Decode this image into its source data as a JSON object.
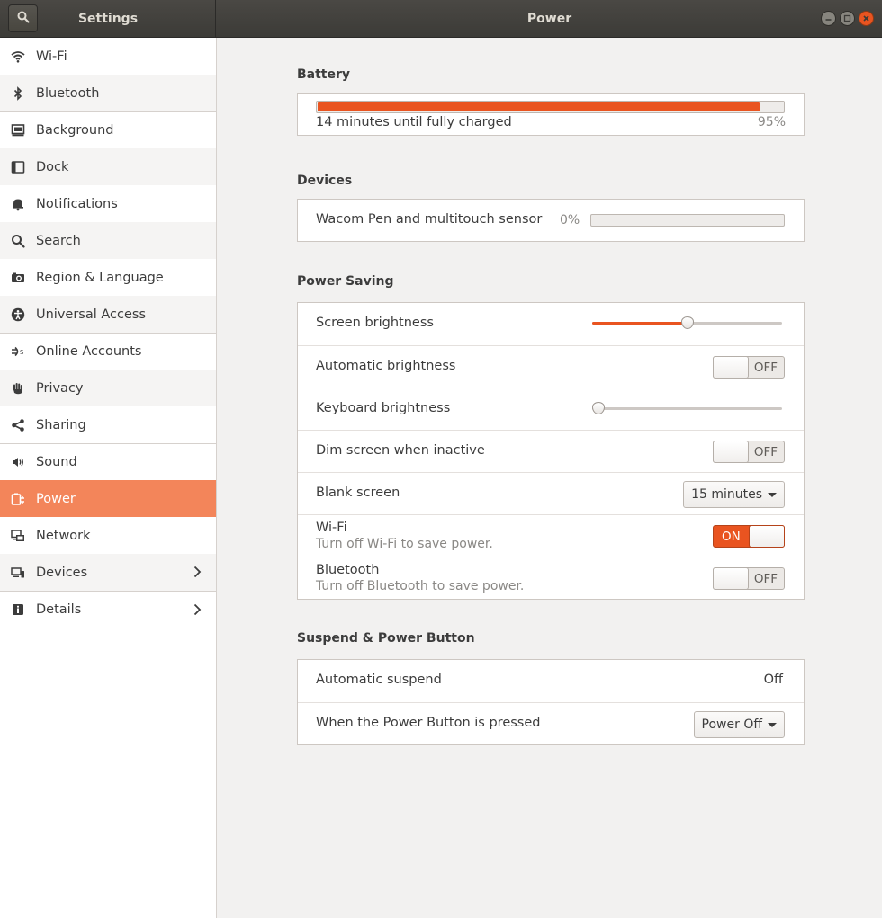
{
  "header": {
    "left_title": "Settings",
    "right_title": "Power",
    "search_icon": "search-icon",
    "window_buttons": [
      "minimize",
      "maximize",
      "close"
    ]
  },
  "sidebar": {
    "items": [
      {
        "label": "Wi-Fi",
        "icon": "wifi-icon"
      },
      {
        "label": "Bluetooth",
        "icon": "bluetooth-icon"
      },
      {
        "label": "Background",
        "icon": "background-icon"
      },
      {
        "label": "Dock",
        "icon": "dock-icon"
      },
      {
        "label": "Notifications",
        "icon": "bell-icon"
      },
      {
        "label": "Search",
        "icon": "search-icon"
      },
      {
        "label": "Region & Language",
        "icon": "camera-icon"
      },
      {
        "label": "Universal Access",
        "icon": "accessibility-icon"
      },
      {
        "label": "Online Accounts",
        "icon": "online-accounts-icon"
      },
      {
        "label": "Privacy",
        "icon": "hand-icon"
      },
      {
        "label": "Sharing",
        "icon": "share-icon"
      },
      {
        "label": "Sound",
        "icon": "speaker-icon"
      },
      {
        "label": "Power",
        "icon": "power-icon",
        "active": true
      },
      {
        "label": "Network",
        "icon": "network-icon"
      },
      {
        "label": "Devices",
        "icon": "devices-icon",
        "has_chevron": true
      },
      {
        "label": "Details",
        "icon": "info-icon",
        "has_chevron": true
      }
    ]
  },
  "battery": {
    "title": "Battery",
    "status": "14 minutes until fully charged",
    "percent_text": "95%",
    "level": 0.95
  },
  "devices": {
    "title": "Devices",
    "name": "Wacom Pen and multitouch sensor",
    "percent_text": "0%",
    "level": 0.0
  },
  "power_saving": {
    "title": "Power Saving",
    "screen_brightness": {
      "label": "Screen brightness",
      "level": 0.5
    },
    "automatic_brightness": {
      "label": "Automatic brightness",
      "state": "OFF"
    },
    "keyboard_brightness": {
      "label": "Keyboard brightness",
      "level": 0.0
    },
    "dim_screen": {
      "label": "Dim screen when inactive",
      "state": "OFF"
    },
    "blank_screen": {
      "label": "Blank screen",
      "value": "15 minutes"
    },
    "wifi": {
      "label": "Wi-Fi",
      "sub": "Turn off Wi-Fi to save power.",
      "state": "ON"
    },
    "bluetooth": {
      "label": "Bluetooth",
      "sub": "Turn off Bluetooth to save power.",
      "state": "OFF"
    }
  },
  "suspend": {
    "title": "Suspend & Power Button",
    "automatic_suspend": {
      "label": "Automatic suspend",
      "value": "Off"
    },
    "power_button": {
      "label": "When the Power Button is pressed",
      "value": "Power Off"
    }
  },
  "colors": {
    "accent": "#e95420",
    "sidebar_active": "#f3855a",
    "headerbar": "#3c3b37"
  }
}
